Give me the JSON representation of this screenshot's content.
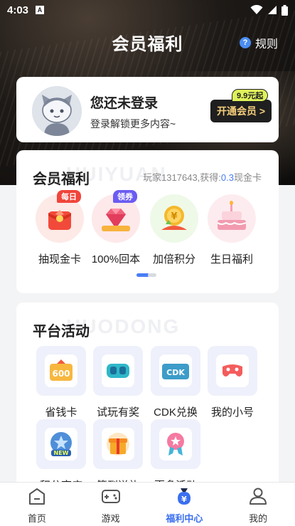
{
  "status_bar": {
    "time": "4:03",
    "notification_letter": "A"
  },
  "header": {
    "title": "会员福利",
    "rules_label": "规则",
    "rules_icon": "question-icon"
  },
  "login_card": {
    "title": "您还未登录",
    "subtitle": "登录解锁更多内容~",
    "price_tag": "9.9元起",
    "open_vip_label": "开通会员 >"
  },
  "benefits": {
    "title": "会员福利",
    "watermark": "HUIYUAN",
    "note_prefix": "玩家1317643,获得:",
    "note_value": "0.3",
    "note_suffix": "现金卡",
    "items": [
      {
        "label": "抽现金卡",
        "badge": "每日",
        "icon": "red-envelope-icon",
        "badge_color": "#f0453a"
      },
      {
        "label": "100%回本",
        "badge": "领券",
        "icon": "diamond-icon",
        "badge_color": "#6b5cf2"
      },
      {
        "label": "加倍积分",
        "badge": "",
        "icon": "gold-coin-icon"
      },
      {
        "label": "生日福利",
        "badge": "",
        "icon": "birthday-cake-icon"
      }
    ],
    "pager": {
      "current": 1,
      "total": 2
    }
  },
  "activities": {
    "title": "平台活动",
    "watermark": "HUODONG",
    "items": [
      {
        "label": "省钱卡",
        "icon": "savings-card-icon"
      },
      {
        "label": "试玩有奖",
        "icon": "vr-goggles-icon"
      },
      {
        "label": "CDK兑换",
        "icon": "cdk-icon"
      },
      {
        "label": "我的小号",
        "icon": "gamepad-icon"
      },
      {
        "label": "积分商店",
        "icon": "new-medal-icon"
      },
      {
        "label": "签到送礼",
        "icon": "gift-box-icon"
      },
      {
        "label": "更多活动",
        "icon": "ribbon-badge-icon"
      }
    ]
  },
  "tabbar": {
    "tabs": [
      {
        "label": "首页",
        "icon": "home-icon",
        "active": false
      },
      {
        "label": "游戏",
        "icon": "controller-icon",
        "active": false
      },
      {
        "label": "福利中心",
        "icon": "yuan-bag-icon",
        "active": true
      },
      {
        "label": "我的",
        "icon": "profile-icon",
        "active": false
      }
    ]
  },
  "colors": {
    "accent": "#3a6ff0",
    "vip_gold": "#f6cf7c",
    "price_tag": "#dff25a"
  }
}
